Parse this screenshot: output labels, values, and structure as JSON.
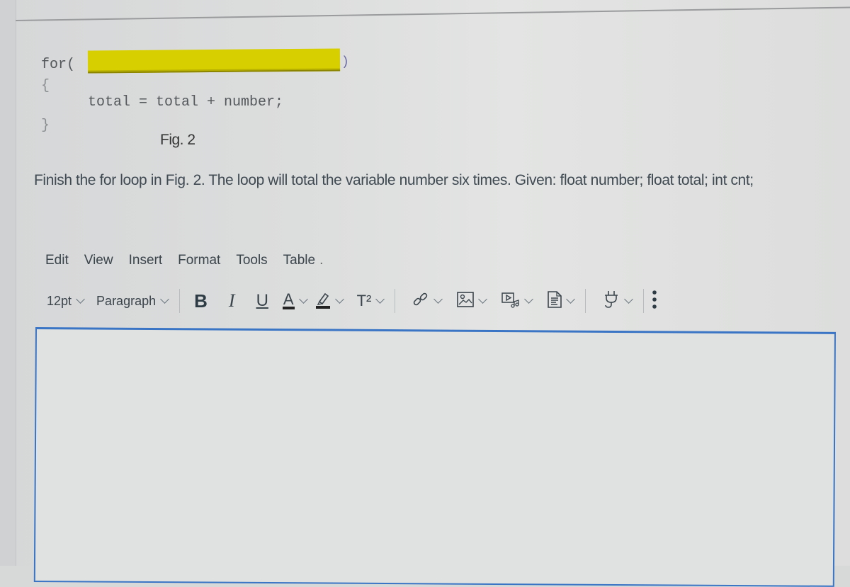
{
  "figure": {
    "code_keyword": "for(",
    "code_close_paren": ")",
    "brace_open": "{",
    "body_statement": "total = total + number;",
    "brace_close": "}",
    "blank_highlight_color": "#d8cf00",
    "caption": "Fig. 2"
  },
  "question": {
    "text": "Finish the for loop in Fig. 2. The loop will total the variable number six times. Given: float number; float total; int cnt;"
  },
  "editor": {
    "menu": [
      "Edit",
      "View",
      "Insert",
      "Format",
      "Tools",
      "Table"
    ],
    "menu_overflow": ".",
    "toolbar": {
      "font_size": "12pt",
      "block_format": "Paragraph",
      "bold": "B",
      "italic": "I",
      "underline": "U",
      "text_color": "A",
      "superscript": "T²",
      "icons": [
        "link-icon",
        "image-icon",
        "media-icon",
        "document-icon",
        "plugin-icon",
        "more-icon"
      ]
    },
    "content": "",
    "border_color": "#3a74c4"
  }
}
